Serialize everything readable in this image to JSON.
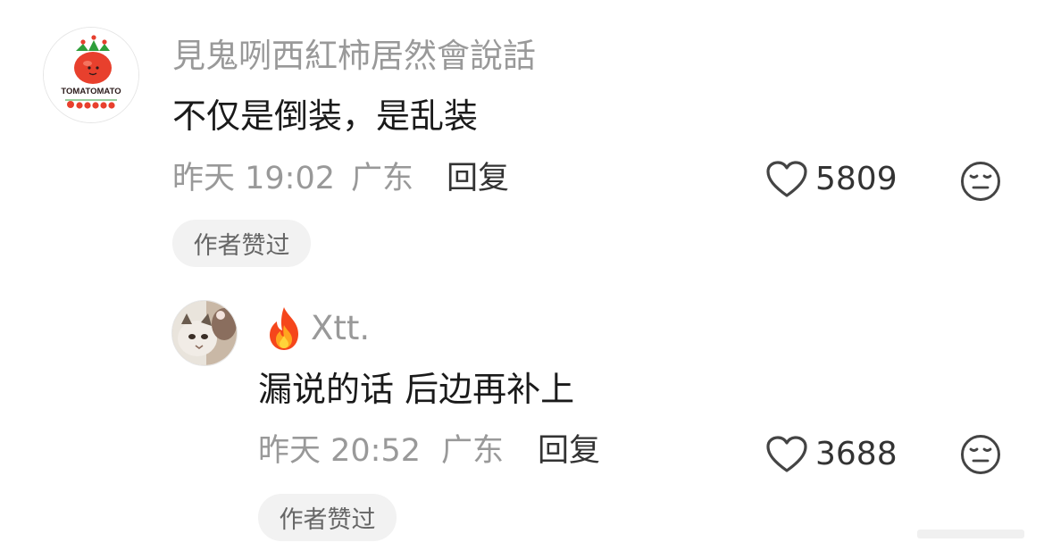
{
  "comments": [
    {
      "author": "見鬼咧西紅柿居然會說話",
      "avatar_logo_text": "TOMATOMATO",
      "text": "不仅是倒装，是乱装",
      "time": "昨天 19:02",
      "location": "广东",
      "reply_label": "回复",
      "likes": "5809",
      "badge": "作者赞过"
    }
  ],
  "replies": [
    {
      "author": "Xtt.",
      "author_prefix_icon": "fire-emoji",
      "text": "漏说的话 后边再补上",
      "time": "昨天 20:52",
      "location": "广东",
      "reply_label": "回复",
      "likes": "3688",
      "badge": "作者赞过"
    }
  ],
  "colors": {
    "secondary_text": "#999999",
    "primary_text": "#1a1a1a",
    "badge_bg": "#f2f2f2",
    "icon_stroke": "#444444"
  }
}
